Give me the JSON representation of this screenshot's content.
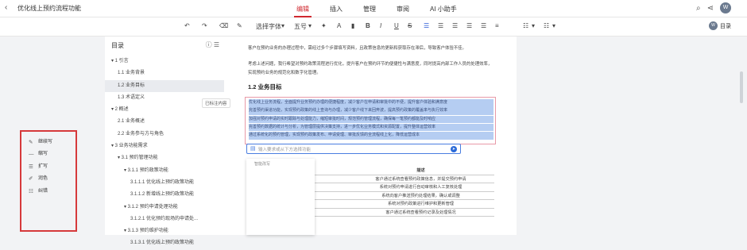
{
  "header": {
    "title": "优化线上预约流程功能",
    "tabs": [
      {
        "label": "编辑",
        "active": true
      },
      {
        "label": "插入",
        "active": false
      },
      {
        "label": "管理",
        "active": false
      },
      {
        "label": "审阅",
        "active": false
      },
      {
        "label": "AI 小助手",
        "active": false
      }
    ],
    "avatar_text": "W"
  },
  "toolbar": {
    "font_family": "选择字体",
    "font_size": "五号",
    "ai_label": "目录",
    "ai_avatar_text": "W"
  },
  "outline": {
    "title": "目录",
    "items": [
      {
        "label": "▾ 1 引言",
        "indent": 0,
        "active": false
      },
      {
        "label": "1.1 业务背景",
        "indent": 1,
        "active": false
      },
      {
        "label": "1.2 业务目标",
        "indent": 1,
        "active": true
      },
      {
        "label": "1.3 术语定义",
        "indent": 1,
        "active": false
      },
      {
        "label": "▾ 2 概述",
        "indent": 0,
        "active": false
      },
      {
        "label": "2.1 业务概述",
        "indent": 1,
        "active": false
      },
      {
        "label": "2.2 业务参与方与角色",
        "indent": 1,
        "active": false
      },
      {
        "label": "▾ 3 业务功能需求",
        "indent": 0,
        "active": false
      },
      {
        "label": "▾ 3.1 预约管理功能",
        "indent": 1,
        "active": false
      },
      {
        "label": "▾ 3.1.1 预约政策功能",
        "indent": 2,
        "active": false
      },
      {
        "label": "3.1.1.1 优化线上预约政策功能",
        "indent": 3,
        "active": false
      },
      {
        "label": "3.1.1.2 新增线上预约政策功能",
        "indent": 3,
        "active": false
      },
      {
        "label": "▾ 3.1.2 预约申请处理功能",
        "indent": 2,
        "active": false
      },
      {
        "label": "3.1.2.1 优化预约现场的申请处...",
        "indent": 3,
        "active": false
      },
      {
        "label": "▾ 3.1.3 预约维护功能",
        "indent": 2,
        "active": false
      },
      {
        "label": "3.1.3.1 优化线上预约政策功能",
        "indent": 3,
        "active": false
      }
    ]
  },
  "document": {
    "para1": "客户在预约业务的办理过程中，需经过多个步骤填写资料，且政策信息的更新和获取存在滞后，导致客户体验不佳。",
    "para2": "考虑上述问题，我行希望对预约政策流程进行优化，提升客户在预约环节的便捷性与满意度，同时提高内部工作人员的处理效率，实现预约业务的规范化和数字化管理。",
    "heading": "1.2 业务目标",
    "selected_lines": [
      "优化线上业务流程，全面提升业务预约办理的便捷程度，减少客户在申请和审批中的不便，提升客户体验和满意度",
      "完善预约渠道功能，实现预约政策的线上查询与办理，减少客户线下来回奔波，提高预约政策的覆盖率与执行效率",
      "加强对预约申请的实时跟踪与处理能力，缩短审批时间，规范预约管理流程，确保每一笔预约都能及时响应",
      "完善预约数据的统计与分析，为管理层提供决策支持，进一步优化业务模式和资源配置，提升整体运营效率",
      "通过系统化的预约管理，实现预约政策发布、申请受理、审批反馈的全流程线上化，降低运营成本"
    ],
    "side_tag": "已标注内容",
    "table_header": [
      "",
      "描述"
    ],
    "table_rows": [
      [
        "",
        "客户通过系统查看预约政策信息，并提交预约申请"
      ],
      [
        "",
        "系统对预约申请进行自动审核和人工复核处理"
      ],
      [
        "",
        "系统向客户推送预约处理结果，确认或调整"
      ],
      [
        "",
        "系统对预约政策进行维护和更新管理"
      ],
      [
        "",
        "客户通过系统查看预约记录及处理情况"
      ]
    ]
  },
  "ai_panel": {
    "input_placeholder": "输入要求或从下方选择功能",
    "menu_label": "智能改写",
    "items": [
      {
        "label": "继续写",
        "icon": "pen-icon"
      },
      {
        "label": "缩写",
        "icon": "shorten-icon"
      },
      {
        "label": "扩写",
        "icon": "expand-icon"
      },
      {
        "label": "润色",
        "icon": "polish-icon"
      },
      {
        "label": "纠错",
        "icon": "check-icon"
      }
    ]
  }
}
